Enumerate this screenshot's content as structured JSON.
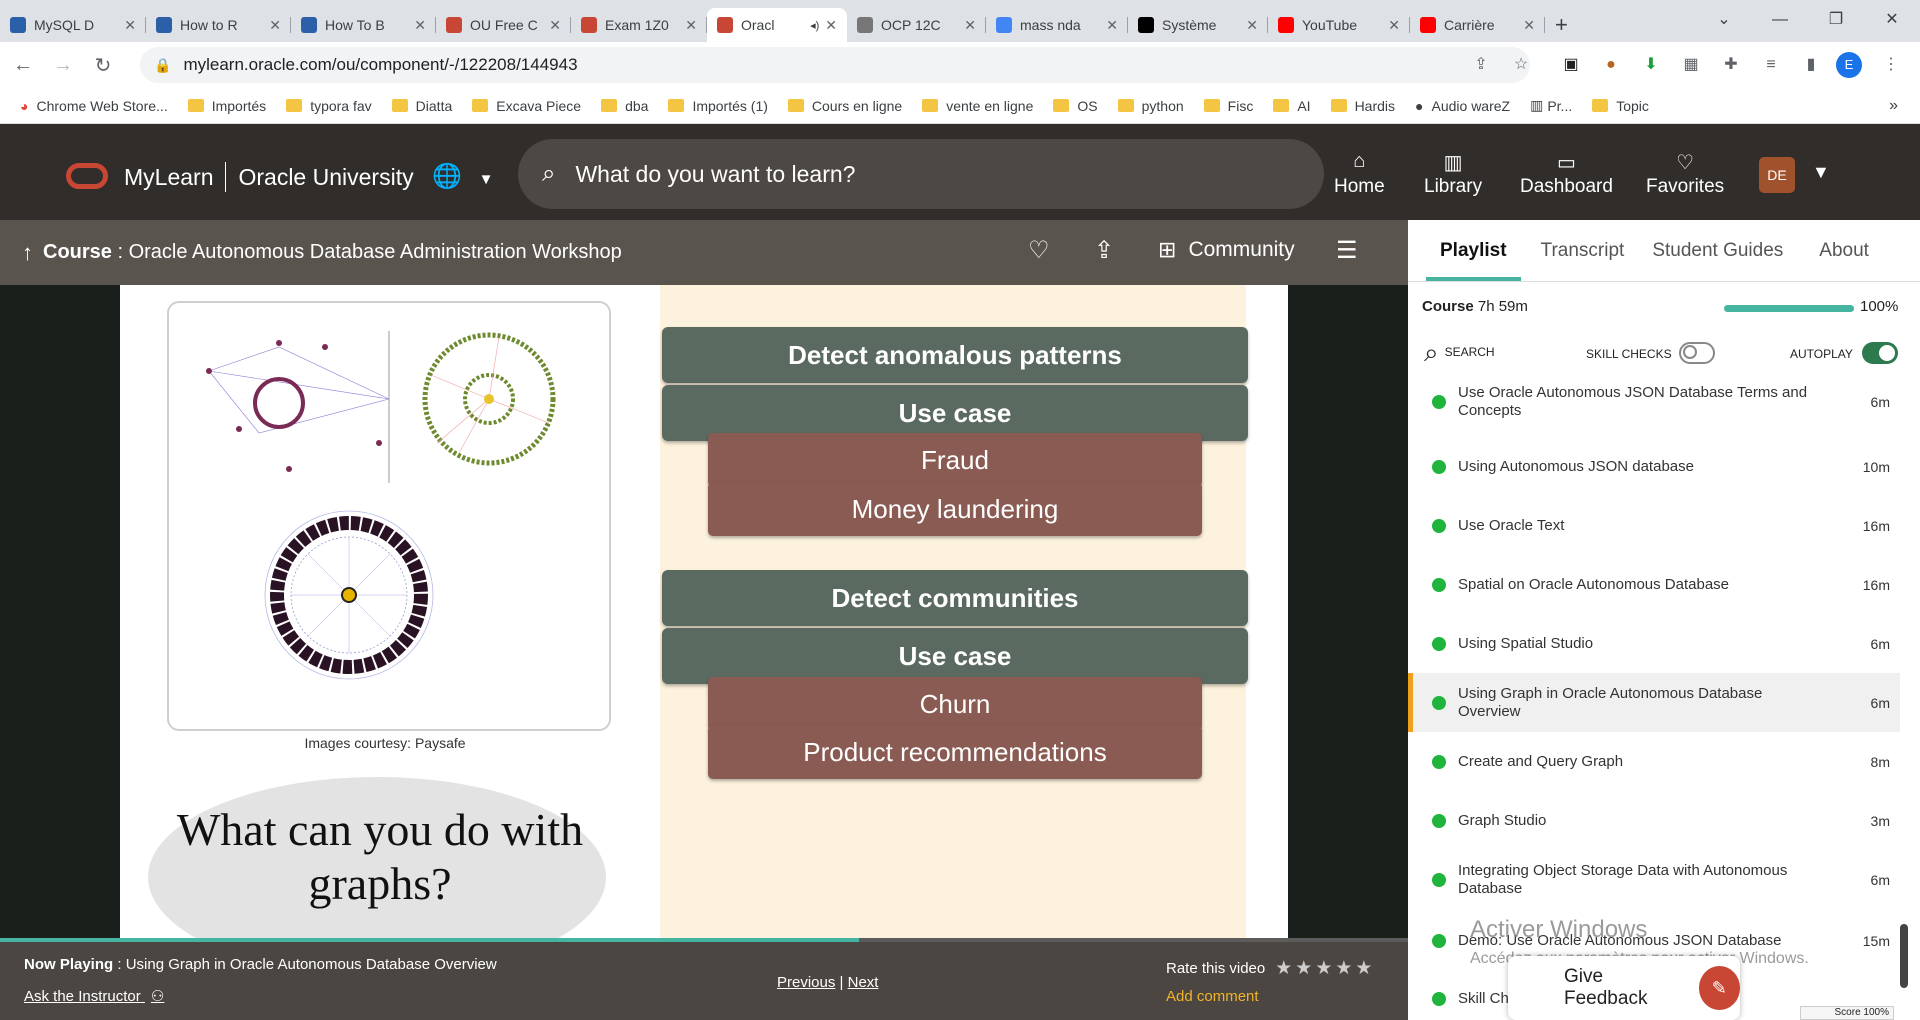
{
  "browser": {
    "tabs": [
      {
        "title": "MySQL D",
        "color": "#2b5fa8"
      },
      {
        "title": "How to R",
        "color": "#2b5fa8"
      },
      {
        "title": "How To B",
        "color": "#2b5fa8"
      },
      {
        "title": "OU Free C",
        "color": "#c74634"
      },
      {
        "title": "Exam 1Z0",
        "color": "#c74634"
      },
      {
        "title": "Oracl",
        "color": "#c74634"
      },
      {
        "title": "OCP 12C",
        "color": "#777777"
      },
      {
        "title": "mass nda",
        "color": "#4285f4"
      },
      {
        "title": "Système",
        "color": "#000000"
      },
      {
        "title": "YouTube",
        "color": "#ff0000"
      },
      {
        "title": "Carrière",
        "color": "#ff0000"
      }
    ],
    "new_tab": "+",
    "url": "mylearn.oracle.com/ou/component/-/122208/144943",
    "profile_initial": "E",
    "bookmarks": [
      "Chrome Web Store...",
      "Importés",
      "typora fav",
      "Diatta",
      "Excava Piece",
      "dba",
      "Importés (1)",
      "Cours en ligne",
      "vente en ligne",
      "OS",
      "python",
      "Fisc",
      "AI",
      "Hardis",
      "Audio wareZ",
      "Pr...",
      "Topic"
    ],
    "more": "»"
  },
  "app": {
    "brand": "MyLearn",
    "org": "Oracle University",
    "search_placeholder": "What do you want to learn?",
    "nav": {
      "home": "Home",
      "library": "Library",
      "dashboard": "Dashboard",
      "favorites": "Favorites"
    },
    "avatar": "DE",
    "accent": "#c74634"
  },
  "course": {
    "label": "Course",
    "sep": " : ",
    "title": "Oracle Autonomous Database Administration Workshop",
    "community": "Community"
  },
  "slide": {
    "courtesy": "Images courtesy: Paysafe",
    "question": "What can you do with graphs?",
    "green1": "Detect anomalous patterns",
    "usecase1": "Use case",
    "item1": "Fraud",
    "item2": "Money laundering",
    "green2": "Detect communities",
    "usecase2": "Use case",
    "item3": "Churn",
    "item4": "Product recommendations"
  },
  "player": {
    "progress": 0.61,
    "now_label": "Now Playing",
    "now_sep": " : ",
    "now_title": "Using Graph in Oracle Autonomous Database Overview",
    "ask": "Ask the Instructor",
    "previous": "Previous",
    "pipe": "|",
    "next": "Next",
    "rate": "Rate this video",
    "stars": 5,
    "add_comment": "Add comment"
  },
  "sidebar": {
    "tabs": [
      "Playlist",
      "Transcript",
      "Student Guides",
      "About"
    ],
    "course_label": "Course",
    "course_duration": "7h 59m",
    "percent": "100%",
    "progress": 1.0,
    "search": "SEARCH",
    "skill_checks": "SKILL CHECKS",
    "autoplay": "AUTOPLAY",
    "skill_on": false,
    "autoplay_on": true,
    "items": [
      {
        "title": "Use Oracle Autonomous JSON Database Terms and Concepts",
        "dur": "6m"
      },
      {
        "title": "Using Autonomous JSON database",
        "dur": "10m"
      },
      {
        "title": "Use Oracle Text",
        "dur": "16m"
      },
      {
        "title": "Spatial on Oracle Autonomous Database",
        "dur": "16m"
      },
      {
        "title": "Using Spatial Studio",
        "dur": "6m"
      },
      {
        "title": "Using Graph in Oracle Autonomous Database Overview",
        "dur": "6m",
        "current": true
      },
      {
        "title": "Create and Query Graph",
        "dur": "8m"
      },
      {
        "title": "Graph Studio",
        "dur": "3m"
      },
      {
        "title": "Integrating Object Storage Data with Autonomous Database",
        "dur": "6m"
      },
      {
        "title": "Demo: Use Oracle Autonomous JSON Database",
        "dur": "15m"
      },
      {
        "title": "Skill Ch",
        "dur": ""
      }
    ],
    "feedback": "Give Feedback",
    "score": "Score 100%"
  },
  "windows_watermark": {
    "line1": "Activer Windows",
    "line2": "Accédez aux paramètres pour activer Windows."
  }
}
